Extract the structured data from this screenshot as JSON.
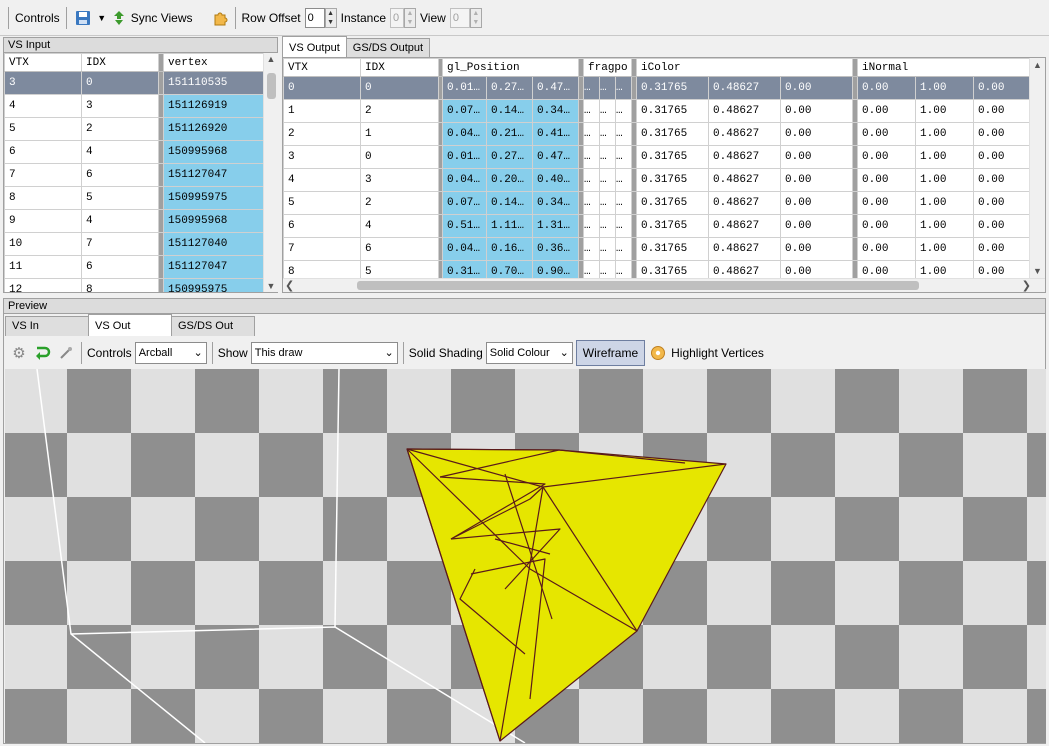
{
  "toolbar": {
    "controls_label": "Controls",
    "sync_views_label": "Sync Views",
    "row_offset_label": "Row Offset",
    "row_offset_value": "0",
    "instance_label": "Instance",
    "instance_value": "0",
    "view_label": "View",
    "view_value": "0"
  },
  "vs_input": {
    "title": "VS Input",
    "columns": [
      "VTX",
      "IDX",
      "vertex"
    ],
    "rows": [
      [
        "3",
        "0",
        "151110535"
      ],
      [
        "4",
        "3",
        "151126919"
      ],
      [
        "5",
        "2",
        "151126920"
      ],
      [
        "6",
        "4",
        "150995968"
      ],
      [
        "7",
        "6",
        "151127047"
      ],
      [
        "8",
        "5",
        "150995975"
      ],
      [
        "9",
        "4",
        "150995968"
      ],
      [
        "10",
        "7",
        "151127040"
      ],
      [
        "11",
        "6",
        "151127047"
      ],
      [
        "12",
        "8",
        "150995975"
      ]
    ]
  },
  "vs_output": {
    "tabs": [
      "VS Output",
      "GS/DS Output"
    ],
    "columns": [
      "VTX",
      "IDX",
      "gl_Position",
      "fragpo",
      "iColor",
      "iNormal"
    ],
    "rows": [
      [
        "0",
        "0",
        "0.01…",
        "0.27…",
        "0.47…",
        "…",
        "…",
        "…",
        "0.31765",
        "0.48627",
        "0.00",
        "0.00",
        "1.00",
        "0.00"
      ],
      [
        "1",
        "2",
        "0.07…",
        "0.14…",
        "0.34…",
        "…",
        "…",
        "…",
        "0.31765",
        "0.48627",
        "0.00",
        "0.00",
        "1.00",
        "0.00"
      ],
      [
        "2",
        "1",
        "0.04…",
        "0.21…",
        "0.41…",
        "…",
        "…",
        "…",
        "0.31765",
        "0.48627",
        "0.00",
        "0.00",
        "1.00",
        "0.00"
      ],
      [
        "3",
        "0",
        "0.01…",
        "0.27…",
        "0.47…",
        "…",
        "…",
        "…",
        "0.31765",
        "0.48627",
        "0.00",
        "0.00",
        "1.00",
        "0.00"
      ],
      [
        "4",
        "3",
        "0.04…",
        "0.20…",
        "0.40…",
        "…",
        "…",
        "…",
        "0.31765",
        "0.48627",
        "0.00",
        "0.00",
        "1.00",
        "0.00"
      ],
      [
        "5",
        "2",
        "0.07…",
        "0.14…",
        "0.34…",
        "…",
        "…",
        "…",
        "0.31765",
        "0.48627",
        "0.00",
        "0.00",
        "1.00",
        "0.00"
      ],
      [
        "6",
        "4",
        "0.51…",
        "1.11…",
        "1.31…",
        "…",
        "…",
        "…",
        "0.31765",
        "0.48627",
        "0.00",
        "0.00",
        "1.00",
        "0.00"
      ],
      [
        "7",
        "6",
        "0.04…",
        "0.16…",
        "0.36…",
        "…",
        "…",
        "…",
        "0.31765",
        "0.48627",
        "0.00",
        "0.00",
        "1.00",
        "0.00"
      ],
      [
        "8",
        "5",
        "0.31…",
        "0.70…",
        "0.90…",
        "…",
        "…",
        "…",
        "0.31765",
        "0.48627",
        "0.00",
        "0.00",
        "1.00",
        "0.00"
      ]
    ]
  },
  "preview": {
    "title": "Preview",
    "tabs": [
      "VS In",
      "VS Out",
      "GS/DS Out"
    ],
    "controls_label": "Controls",
    "controls_value": "Arcball",
    "show_label": "Show",
    "show_value": "This draw",
    "solid_shading_label": "Solid Shading",
    "solid_shading_value": "Solid Colour",
    "wireframe_label": "Wireframe",
    "highlight_label": "Highlight Vertices"
  },
  "colors": {
    "selected_row": "#7e8a9e",
    "data_column_bg": "#87ceeb",
    "mesh_fill": "#e6e600",
    "mesh_wire": "#5a1a1a",
    "checker_dark": "#8f8f8f",
    "checker_light": "#e0e0e0"
  },
  "icons": [
    "save-icon",
    "sync-views-icon",
    "plugin-icon",
    "settings-icon",
    "reset-icon",
    "pick-icon",
    "highlight-icon"
  ]
}
